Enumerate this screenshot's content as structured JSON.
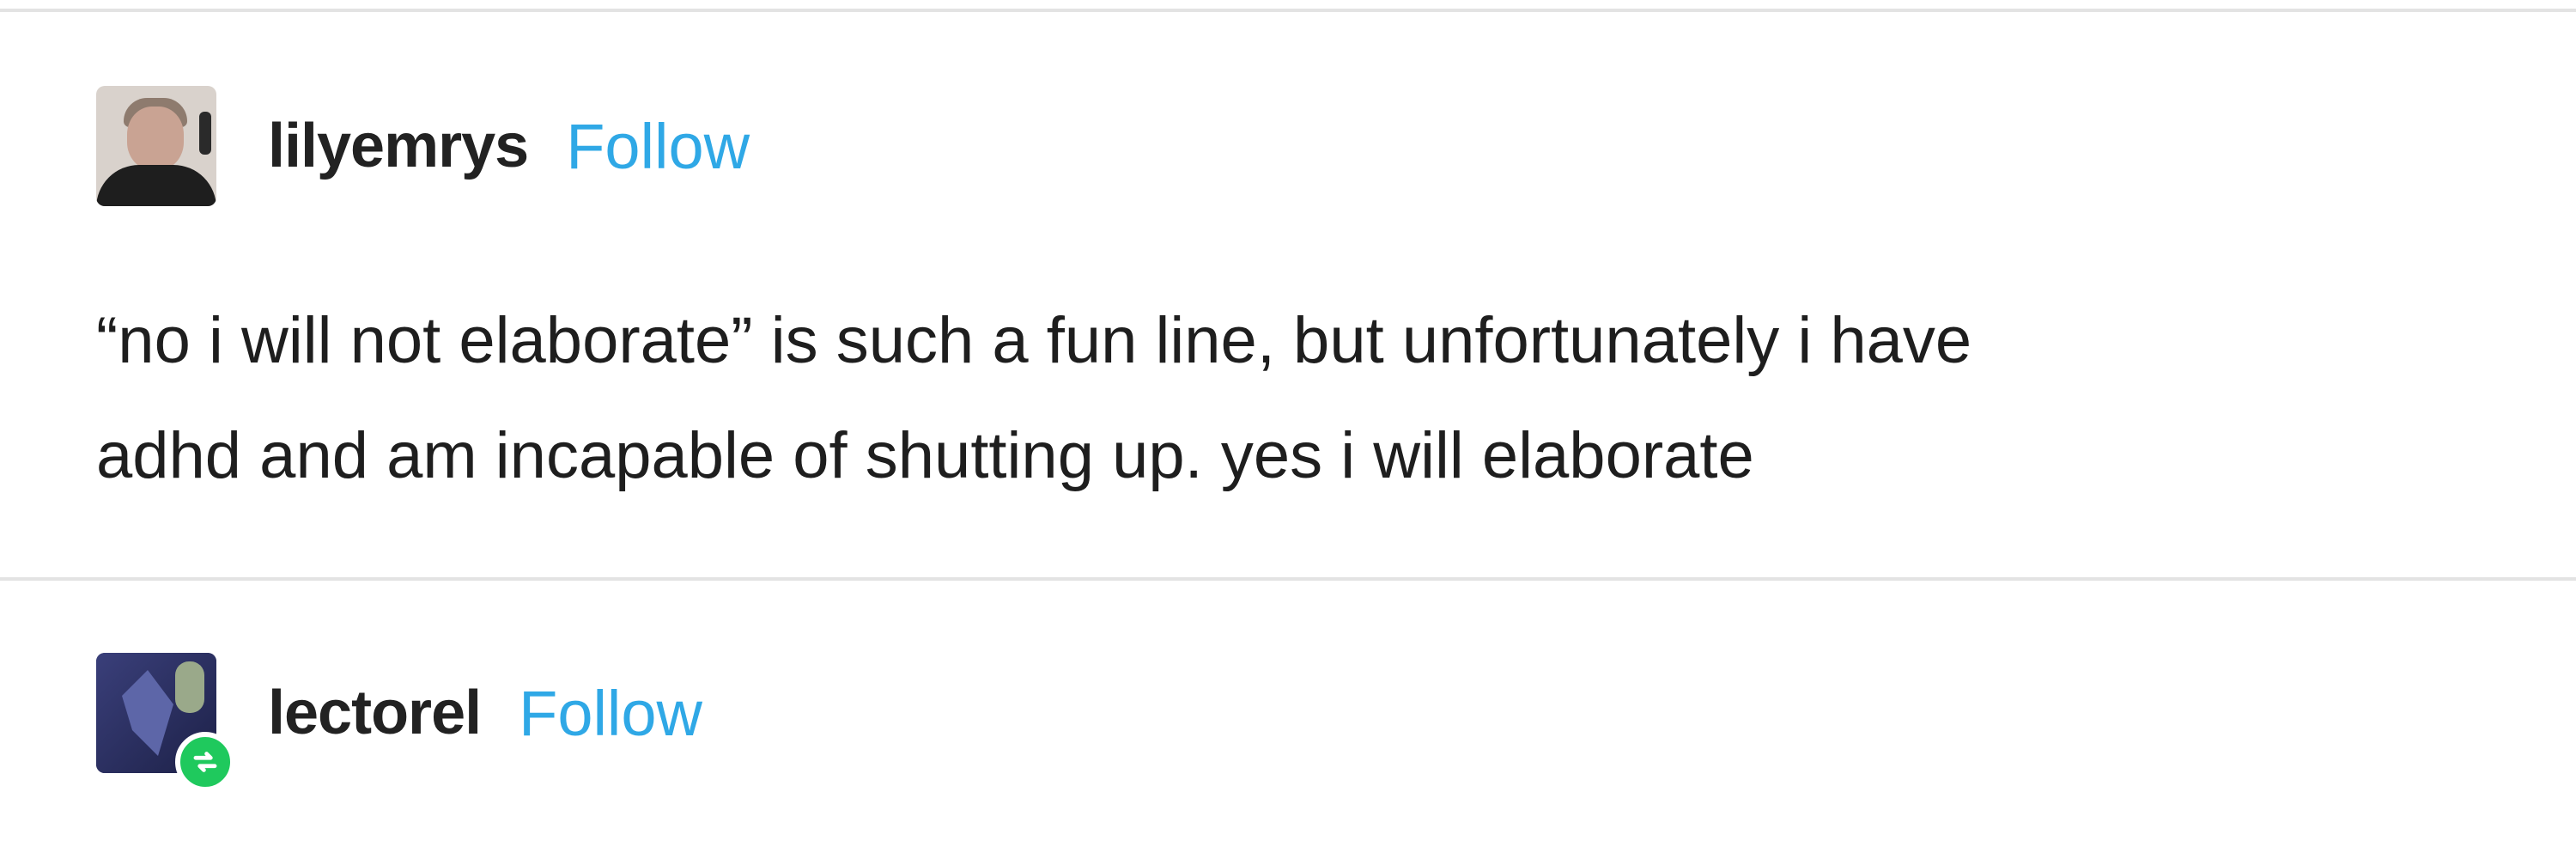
{
  "posts": [
    {
      "username": "lilyemrys",
      "follow_label": "Follow",
      "avatar_icon": "user-photo-avatar",
      "body_lines": [
        "“no i will not elaborate” is such a fun line, but unfortunately i have",
        "adhd and am incapable of shutting up. yes i will elaborate"
      ]
    },
    {
      "username": "lectorel",
      "follow_label": "Follow",
      "avatar_icon": "artwork-avatar",
      "badge_icon": "reblog-icon"
    }
  ],
  "colors": {
    "follow_link": "#2fa8e6",
    "reblog_badge": "#1fc95d",
    "divider": "#e3e3e3",
    "text": "#1e1e1e"
  }
}
